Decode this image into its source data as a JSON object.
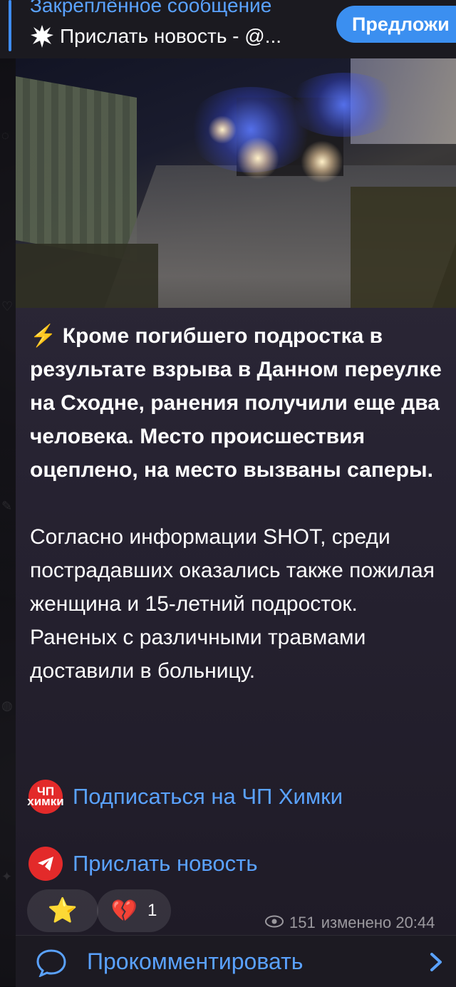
{
  "pinned": {
    "title": "Закреплённое сообщение",
    "text": "Прислать новость - @...",
    "suggest_button": "Предложи"
  },
  "message": {
    "bolt_icon": "⚡",
    "bold_text": "Кроме погибшего подростка в результате взрыва в Данном переулке на Сходне, ранения получили еще два человека. Место происшествия оцеплено, на место вызваны саперы.",
    "body_text": "Согласно информации SHOT, среди пострадавших оказались также пожилая женщина и 15-летний подросток. Раненых с различными травмами доставили в больницу.",
    "subscribe_icon_text": "ЧП\nхимки",
    "subscribe_link": "Подписаться на ЧП Химки",
    "send_news_link": "Прислать новость"
  },
  "reactions": {
    "star_icon": "⭐",
    "heart_icon": "💔",
    "heart_count": "1"
  },
  "meta": {
    "views": "151",
    "edited": "изменено 20:44"
  },
  "comment": {
    "label": "Прокомментировать"
  },
  "colors": {
    "accent": "#3b8ff0",
    "link": "#5aa2ff",
    "bubble": "#2b2735",
    "red_icon": "#e32a2a"
  }
}
